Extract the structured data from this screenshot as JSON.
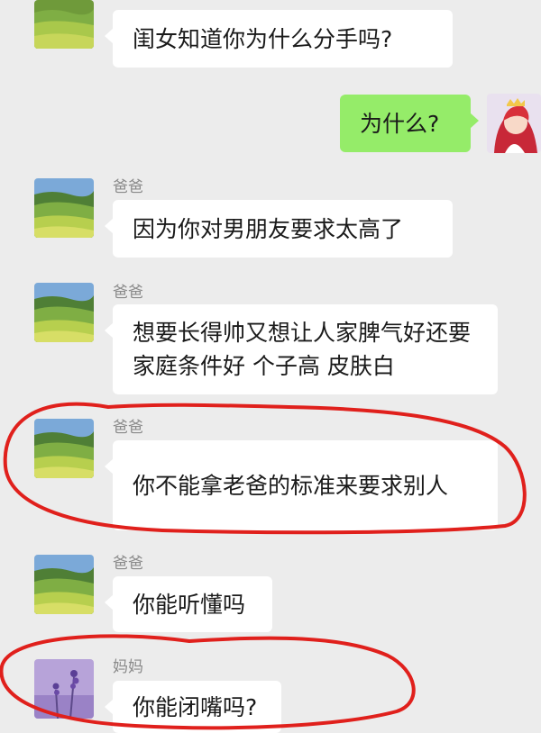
{
  "messages": [
    {
      "sender": "",
      "text": "闺女知道你为什么分手吗?",
      "side": "left",
      "avatar_icon": "landscape-icon"
    },
    {
      "sender": "",
      "text": "为什么?",
      "side": "right",
      "avatar_icon": "princess-icon"
    },
    {
      "sender": "爸爸",
      "text": "因为你对男朋友要求太高了",
      "side": "left",
      "avatar_icon": "landscape-icon"
    },
    {
      "sender": "爸爸",
      "text": "想要长得帅又想让人家脾气好还要家庭条件好 个子高 皮肤白",
      "side": "left",
      "avatar_icon": "landscape-icon"
    },
    {
      "sender": "爸爸",
      "text": "你不能拿老爸的标准来要求别人",
      "side": "left",
      "avatar_icon": "landscape-icon"
    },
    {
      "sender": "爸爸",
      "text": "你能听懂吗",
      "side": "left",
      "avatar_icon": "landscape-icon"
    },
    {
      "sender": "妈妈",
      "text": "你能闭嘴吗?",
      "side": "left",
      "avatar_icon": "lavender-icon"
    }
  ],
  "colors": {
    "background": "#ececec",
    "bubble_incoming": "#ffffff",
    "bubble_outgoing": "#95ec69",
    "annotation": "#e0201c"
  }
}
